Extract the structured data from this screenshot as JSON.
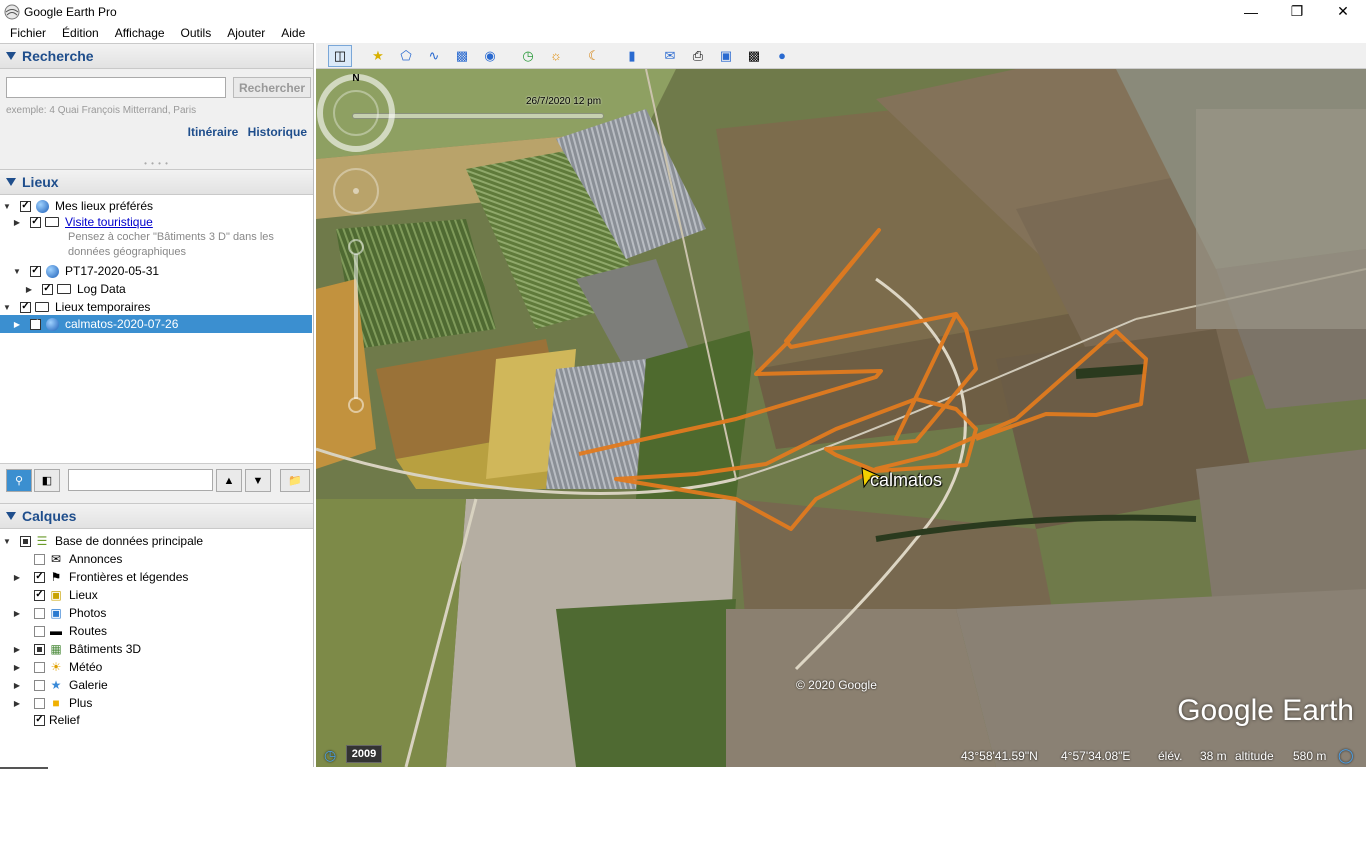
{
  "window": {
    "title": "Google Earth Pro"
  },
  "menu": [
    "Fichier",
    "Édition",
    "Affichage",
    "Outils",
    "Ajouter",
    "Aide"
  ],
  "search": {
    "header": "Recherche",
    "placeholder": "",
    "button": "Rechercher",
    "hint": "exemple:  4 Quai François Mitterrand, Paris",
    "link_directions": "Itinéraire",
    "link_history": "Historique"
  },
  "places": {
    "header": "Lieux",
    "items": [
      {
        "label": "Mes lieux préférés"
      },
      {
        "label": "Visite touristique"
      },
      {
        "label": "Pensez à cocher \"Bâtiments 3 D\" dans les"
      },
      {
        "label": "données géographiques"
      },
      {
        "label": "PT17-2020-05-31"
      },
      {
        "label": "Log Data"
      },
      {
        "label": "Lieux temporaires"
      },
      {
        "label": "calmatos-2020-07-26"
      }
    ]
  },
  "layers": {
    "header": "Calques",
    "items": [
      {
        "label": "Base de données principale"
      },
      {
        "label": "Annonces"
      },
      {
        "label": "Frontières et légendes"
      },
      {
        "label": "Lieux"
      },
      {
        "label": "Photos"
      },
      {
        "label": "Routes"
      },
      {
        "label": "Bâtiments 3D"
      },
      {
        "label": "Météo"
      },
      {
        "label": "Galerie"
      },
      {
        "label": "Plus"
      },
      {
        "label": "Relief"
      }
    ]
  },
  "map": {
    "timeline_label": "26/7/2020   12 pm",
    "placemark": "calmatos",
    "copyright": "© 2020 Google",
    "brand": "Google Earth",
    "year": "2009",
    "lat": "43°58'41.59\"N",
    "lon": "4°57'34.08\"E",
    "elev_label": "élév.",
    "elev_value": "38 m",
    "alt_label": "altitude",
    "alt_value": "580 m",
    "compass_n": "N",
    "track_color": "#e07a1f"
  }
}
